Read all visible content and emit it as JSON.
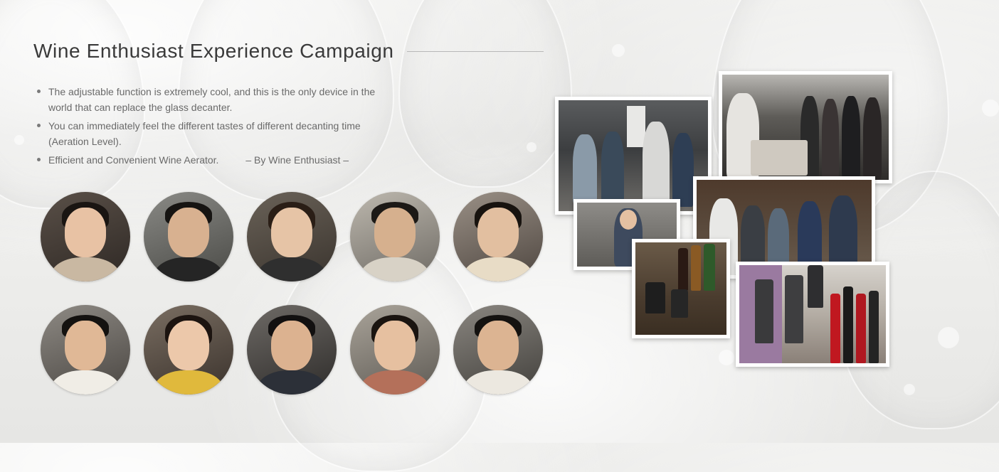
{
  "title": "Wine Enthusiast Experience Campaign",
  "bullets": [
    "The adjustable function is extremely cool, and this is the only device in the world that can replace the glass decanter.",
    "You can immediately feel the different tastes of different decanting time (Aeration Level).",
    "Efficient and Convenient Wine Aerator."
  ],
  "byline": "– By Wine Enthusiast –",
  "portraits": [
    {
      "name": "portrait-1"
    },
    {
      "name": "portrait-2"
    },
    {
      "name": "portrait-3"
    },
    {
      "name": "portrait-4"
    },
    {
      "name": "portrait-5"
    },
    {
      "name": "portrait-6"
    },
    {
      "name": "portrait-7"
    },
    {
      "name": "portrait-8"
    },
    {
      "name": "portrait-9"
    },
    {
      "name": "portrait-10"
    }
  ],
  "collage_photos": [
    "event-crowd-photo",
    "demo-table-photo",
    "woman-selfie-photo",
    "group-seated-photo",
    "aerator-closeup-photo",
    "wine-bottles-display-photo"
  ],
  "colors": {
    "title": "#3a3a3a",
    "body_text": "#6a6a6a",
    "rule": "#b8b8b8",
    "photo_border": "#ffffff"
  }
}
